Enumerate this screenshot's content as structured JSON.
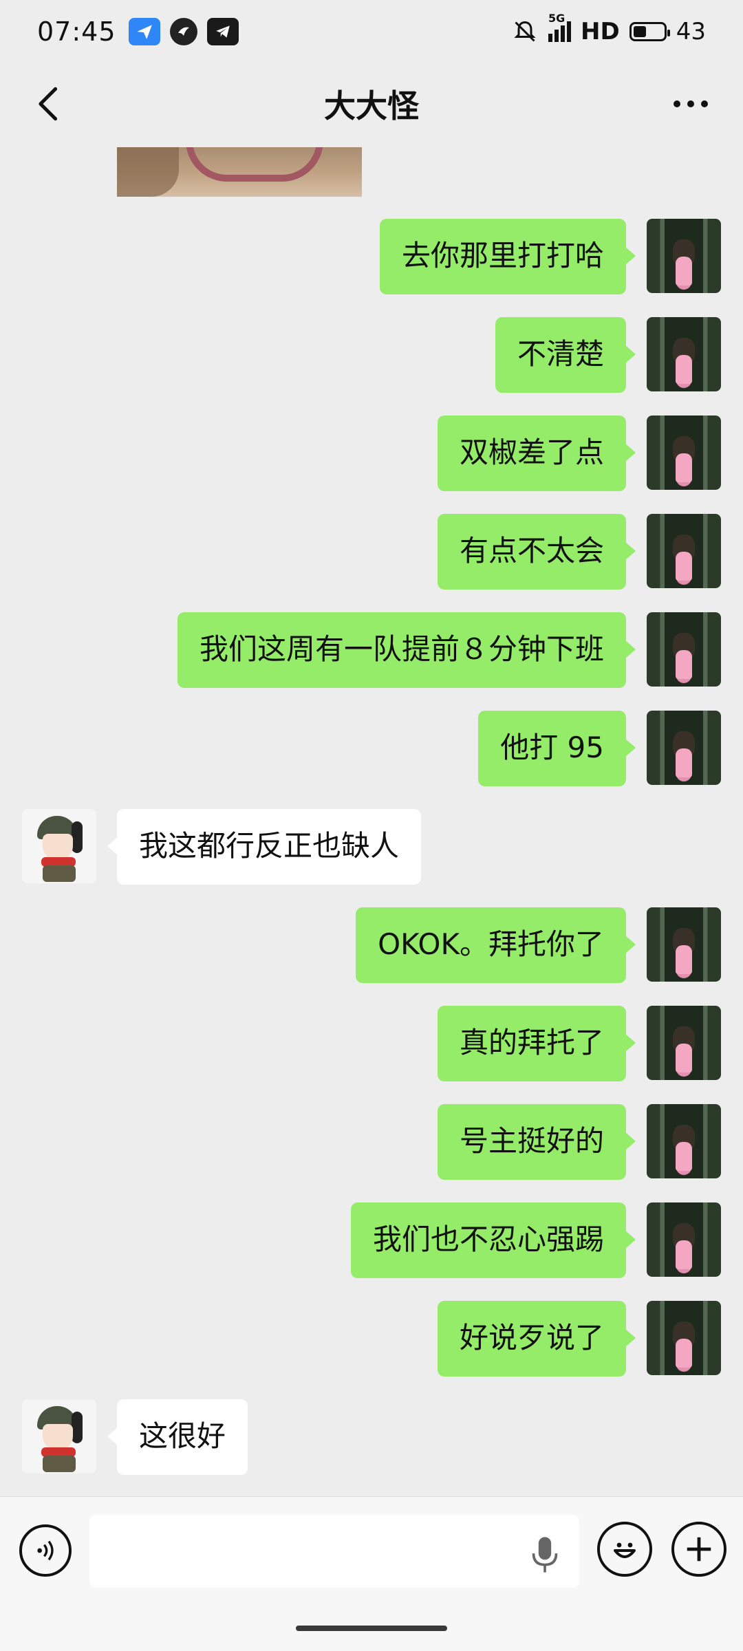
{
  "status_bar": {
    "time": "07:45",
    "network": "5G",
    "hd": "HD",
    "battery": "43",
    "battery_level_percent": 43,
    "app_icons": [
      "paper-plane-app-icon",
      "swallow-app-icon",
      "telegram-icon"
    ]
  },
  "nav": {
    "title": "大大怪",
    "back_icon": "chevron-left-icon",
    "more_icon": "more-dots-icon"
  },
  "messages": [
    {
      "side": "right",
      "text": "去你那里打打哈"
    },
    {
      "side": "right",
      "text": "不清楚"
    },
    {
      "side": "right",
      "text": "双椒差了点"
    },
    {
      "side": "right",
      "text": "有点不太会"
    },
    {
      "side": "right",
      "text": "我们这周有一队提前８分钟下班"
    },
    {
      "side": "right",
      "text": "他打 95"
    },
    {
      "side": "left",
      "text": "我这都行反正也缺人"
    },
    {
      "side": "right",
      "text": "OKOK。拜托你了"
    },
    {
      "side": "right",
      "text": "真的拜托了"
    },
    {
      "side": "right",
      "text": "号主挺好的"
    },
    {
      "side": "right",
      "text": "我们也不忍心强踢"
    },
    {
      "side": "right",
      "text": "好说歹说了"
    },
    {
      "side": "left",
      "text": "这很好"
    }
  ],
  "input_bar": {
    "placeholder": "",
    "voice_icon": "voice-icon",
    "mic_icon": "microphone-icon",
    "emoji_icon": "emoji-icon",
    "plus_icon": "plus-icon"
  },
  "colors": {
    "sent_bubble": "#95ec69",
    "received_bubble": "#ffffff",
    "background": "#ededed"
  }
}
